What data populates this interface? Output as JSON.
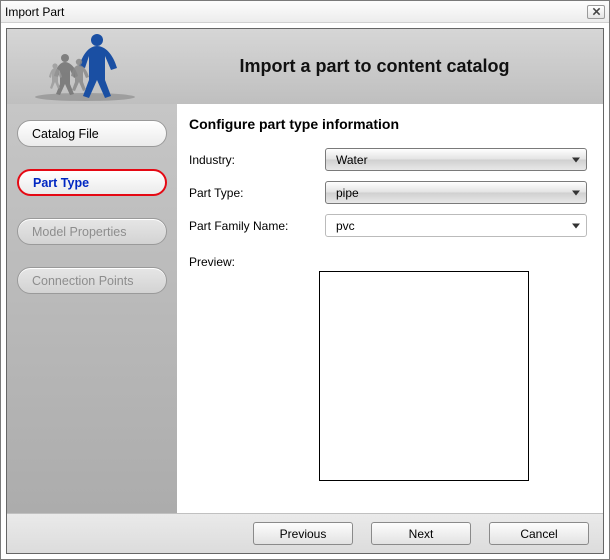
{
  "window": {
    "title": "Import Part"
  },
  "header": {
    "heading": "Import a part to content catalog"
  },
  "sidebar": {
    "items": [
      {
        "label": "Catalog File",
        "state": "enabled"
      },
      {
        "label": "Part Type",
        "state": "selected"
      },
      {
        "label": "Model Properties",
        "state": "disabled"
      },
      {
        "label": "Connection Points",
        "state": "disabled"
      }
    ]
  },
  "content": {
    "subtitle": "Configure part type information",
    "fields": {
      "industry_label": "Industry:",
      "industry_value": "Water",
      "part_type_label": "Part Type:",
      "part_type_value": "pipe",
      "family_label": "Part Family Name:",
      "family_value": "pvc",
      "preview_label": "Preview:"
    }
  },
  "footer": {
    "previous": "Previous",
    "next": "Next",
    "cancel": "Cancel"
  }
}
